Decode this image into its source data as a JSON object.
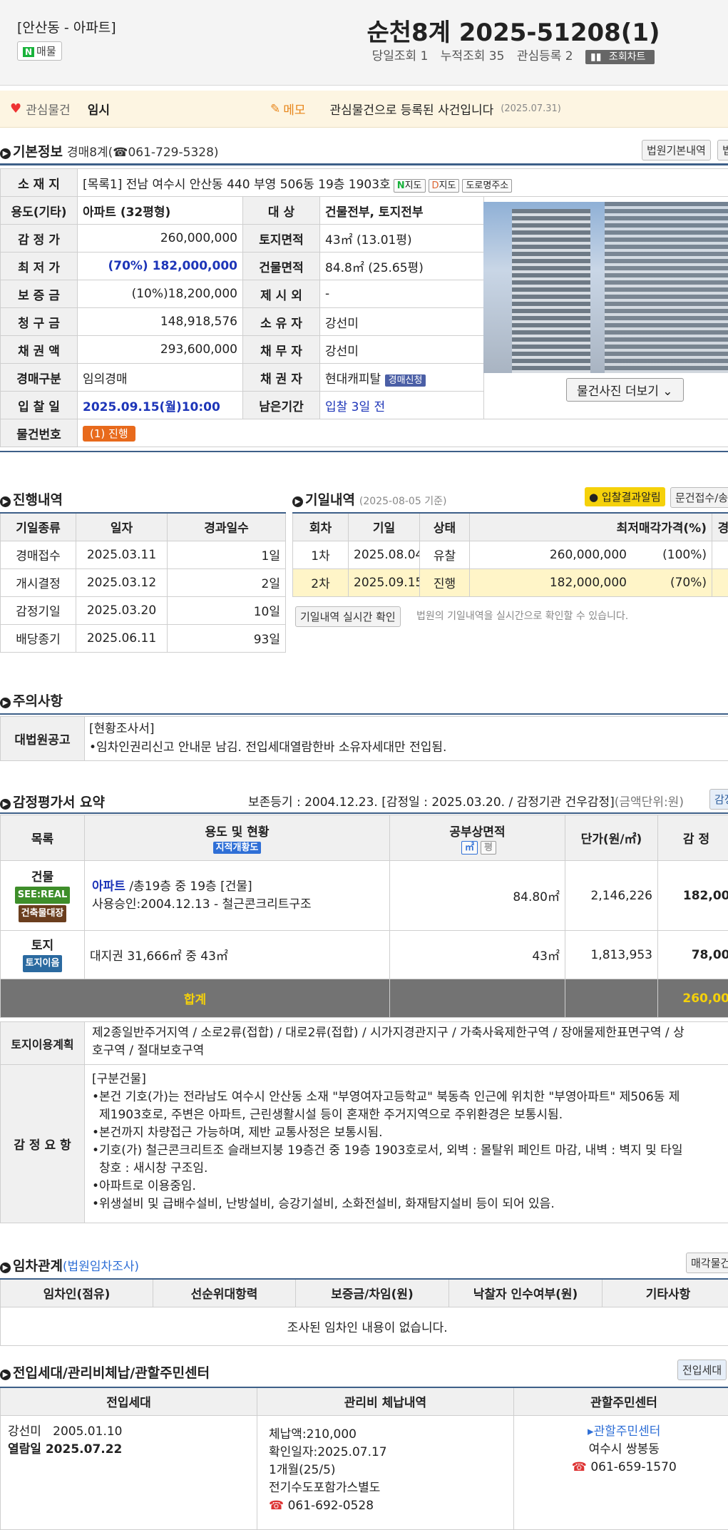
{
  "header": {
    "location": "[안산동 - 아파트]",
    "n_label": "N",
    "n_btn": "매물",
    "title": "순천8계 2025-51208(1)",
    "today": "당일조회 1",
    "total": "누적조회 35",
    "interest": "관심등록 2",
    "chart_btn": "조회차트"
  },
  "interest_bar": {
    "label": "관심물건",
    "value": "임시",
    "memo": "메모",
    "memo_text": "관심물건으로 등록된 사건입니다",
    "memo_date": "(2025.07.31)"
  },
  "basic": {
    "title": "기본정보",
    "sub": "경매8계(☎061-729-5328)",
    "btn1": "법원기본내역",
    "btn2": "법",
    "addr_label": "소 재 지",
    "addr": "[목록1] 전남 여수시 안산동 440 부영 506동 19층 1903호",
    "map1": "지도",
    "map2": "지도",
    "road": "도로명주소",
    "use_label": "용도(기타)",
    "use": "아파트 (32평형)",
    "target_label": "대 상",
    "target": "건물전부, 토지전부",
    "appr_label": "감 정 가",
    "appr": "260,000,000",
    "land_label": "토지면적",
    "land": "43㎡ (13.01평)",
    "min_label": "최 저 가",
    "min": "(70%) 182,000,000",
    "bldg_label": "건물면적",
    "bldg": "84.8㎡ (25.65평)",
    "dep_label": "보 증 금",
    "dep": "(10%)18,200,000",
    "excl_label": "제 시 외",
    "excl": "-",
    "claim_label": "청 구 금",
    "claim": "148,918,576",
    "owner_label": "소 유 자",
    "owner": "강선미",
    "debt_label": "채 권 액",
    "debt": "293,600,000",
    "debtor_label": "채 무 자",
    "debtor": "강선미",
    "type_label": "경매구분",
    "type": "임의경매",
    "creditor_label": "채 권 자",
    "creditor": "현대캐피탈",
    "creditor_badge": "경매신청",
    "bid_label": "입 찰 일",
    "bid": "2025.09.15(월)10:00",
    "remain_label": "남은기간",
    "remain": "입찰 3일 전",
    "no_label": "물건번호",
    "no": "(1) 진행",
    "photo_btn": "물건사진 더보기"
  },
  "progress": {
    "title": "진행내역",
    "cols": [
      "기일종류",
      "일자",
      "경과일수"
    ],
    "rows": [
      [
        "경매접수",
        "2025.03.11",
        "1일"
      ],
      [
        "개시결정",
        "2025.03.12",
        "2일"
      ],
      [
        "감정기일",
        "2025.03.20",
        "10일"
      ],
      [
        "배당종기",
        "2025.06.11",
        "93일"
      ]
    ]
  },
  "dates": {
    "title": "기일내역",
    "sub": "(2025-08-05 기준)",
    "alarm": "입찰결과알림",
    "btn": "문건접수/송",
    "cols": [
      "회차",
      "기일",
      "상태",
      "최저매각가격(%)",
      "경"
    ],
    "rows": [
      [
        "1차",
        "2025.08.04",
        "유찰",
        "260,000,000",
        "(100%)"
      ],
      [
        "2차",
        "2025.09.15",
        "진행",
        "182,000,000",
        "(70%)"
      ]
    ],
    "check_btn": "기일내역 실시간 확인",
    "check_note": "법원의 기일내역을 실시간으로 확인할 수 있습니다."
  },
  "notice": {
    "title": "주의사항",
    "label": "대법원공고",
    "line1": "[현황조사서]",
    "line2": "•임차인권리신고 안내문 남김. 전입세대열람한바 소유자세대만 전입됨."
  },
  "appraisal": {
    "title": "감정평가서 요약",
    "info": "보존등기 : 2004.12.23. [감정일 : 2025.03.20. / 감정기관 건우감정]",
    "unit": "(금액단위:원)",
    "btn": "감정",
    "cols": [
      "목록",
      "용도 및 현황",
      "공부상면적",
      "단가(원/㎡)",
      "감 정"
    ],
    "col_badge": "지적개황도",
    "m2": "㎡",
    "py": "평",
    "r1_label": "건물",
    "r1_b1": "SEE:REAL",
    "r1_b2": "건축물대장",
    "r1_use": "아파트",
    "r1_rest": "/총19층 중 19층 [건물]",
    "r1_line2": "사용승인:2004.12.13 - 철근콘크리트구조",
    "r1_area": "84.80㎡",
    "r1_unit": "2,146,226",
    "r1_val": "182,00",
    "r2_label": "토지",
    "r2_b1": "토지이음",
    "r2_use": "대지권 31,666㎡ 중 43㎡",
    "r2_area": "43㎡",
    "r2_unit": "1,813,953",
    "r2_val": "78,00",
    "total_label": "합계",
    "total_val": "260,00",
    "plan_label": "토지이용계획",
    "plan": "제2종일반주거지역 / 소로2류(접합) / 대로2류(접합) / 시가지경관지구 / 가축사육제한구역 / 장애물제한표면구역 / 상",
    "plan2": "호구역 / 절대보호구역",
    "sum_label": "감 정 요 항",
    "sum_l0": "[구분건물]",
    "sum_l1": "•본건 기호(가)는 전라남도 여수시 안산동 소재 \"부영여자고등학교\" 북동측 인근에 위치한 \"부영아파트\" 제506동 제",
    "sum_l2": "제1903호로, 주변은 아파트, 근린생활시설 등이 혼재한 주거지역으로 주위환경은 보통시됨.",
    "sum_l3": "•본건까지 차량접근 가능하며, 제반 교통사정은 보통시됨.",
    "sum_l4": "•기호(가) 철근콘크리트조 슬래브지붕 19층건 중 19층 1903호로서, 외벽 : 몰탈위 페인트 마감, 내벽 : 벽지 및 타일",
    "sum_l5": "창호 : 새시창 구조임.",
    "sum_l6": "•아파트로 이용중임.",
    "sum_l7": "•위생설비 및 급배수설비, 난방설비, 승강기설비, 소화전설비, 화재탐지설비 등이 되어 있음."
  },
  "lease": {
    "title": "임차관계",
    "sub": "(법원임차조사)",
    "btn": "매각물건",
    "cols": [
      "임차인(점유)",
      "선순위대항력",
      "보증금/차임(원)",
      "낙찰자 인수여부(원)",
      "기타사항"
    ],
    "empty": "조사된 임차인 내용이 없습니다."
  },
  "resident": {
    "title": "전입세대/관리비체납/관할주민센터",
    "btn": "전입세대",
    "cols": [
      "전입세대",
      "관리비 체납내역",
      "관할주민센터"
    ],
    "name": "강선미",
    "date": "2005.01.10",
    "view": "열람일 2025.07.22",
    "arrears": "체납액:210,000",
    "confirm": "확인일자:2025.07.17",
    "period": "1개월(25/5)",
    "utility": "전기수도포함가스별도",
    "phone": "061-692-0528",
    "center_link": "관할주민센터",
    "center": "여수시 쌍봉동",
    "center_phone": "061-659-1570"
  }
}
